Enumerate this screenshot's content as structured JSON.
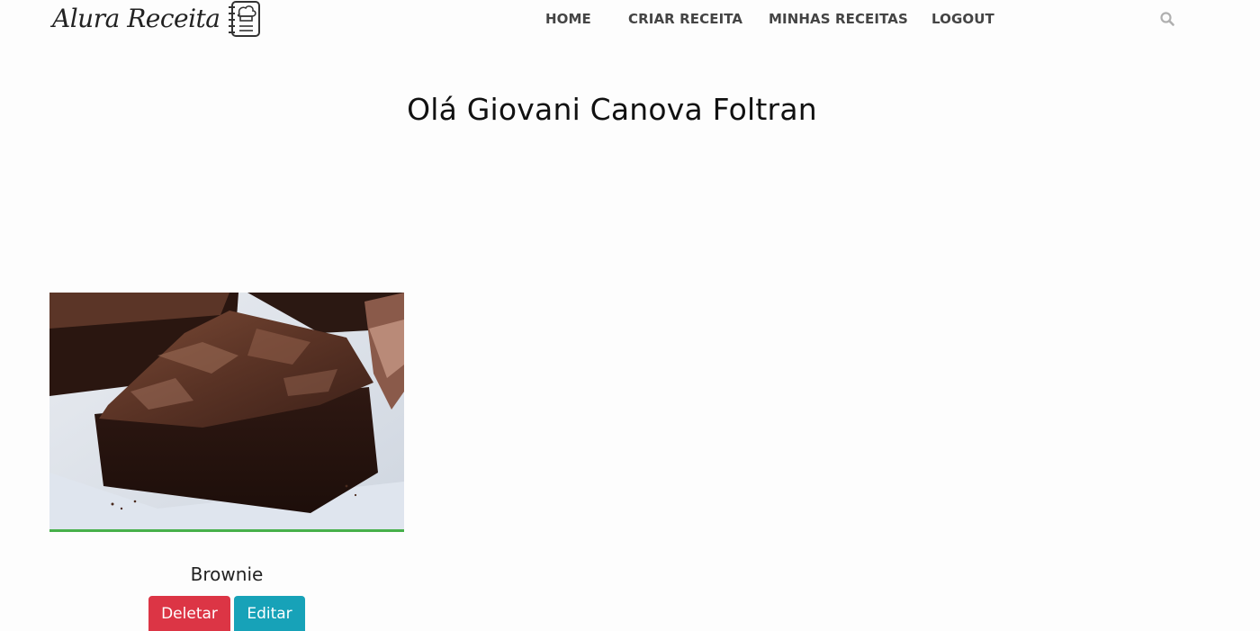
{
  "header": {
    "logo_text": "Alura Receita",
    "logo_icon": "chef-notebook-icon",
    "nav": [
      {
        "label": "HOME"
      },
      {
        "label": "CRIAR RECEITA"
      },
      {
        "label": "MINHAS RECEITAS"
      },
      {
        "label": "LOGOUT"
      }
    ],
    "search_icon": "search-icon"
  },
  "main": {
    "greeting": "Olá Giovani Canova Foltran",
    "recipes": [
      {
        "title": "Brownie",
        "image": "brownie-photo",
        "delete_label": "Deletar",
        "edit_label": "Editar"
      }
    ]
  },
  "colors": {
    "delete": "#dc3545",
    "edit": "#17a2b8",
    "card_accent": "#46b04a",
    "nav_text": "#444444",
    "search_icon": "#b0b0b0"
  }
}
